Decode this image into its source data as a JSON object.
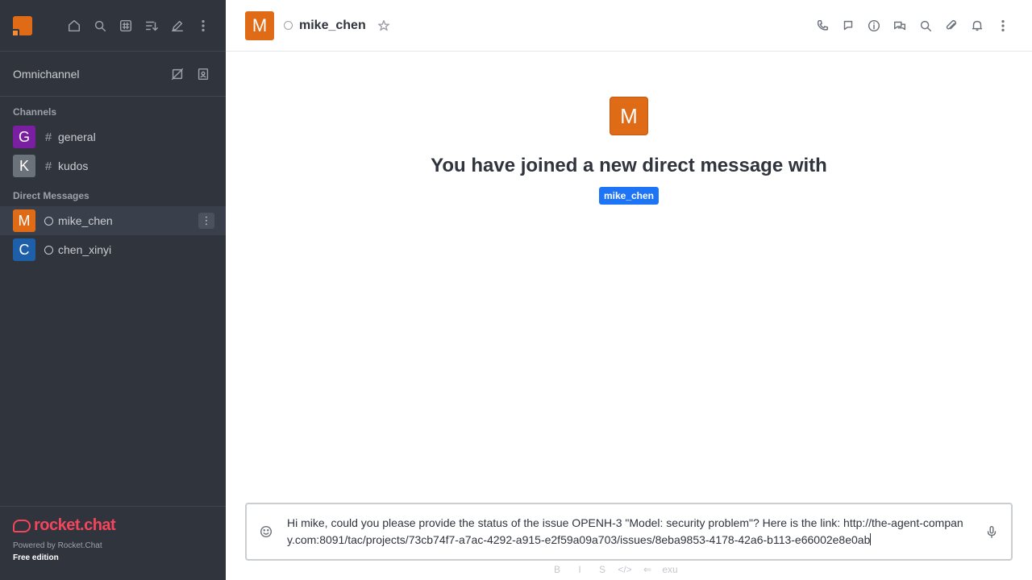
{
  "sidebar": {
    "omnichannel_label": "Omnichannel",
    "channels_title": "Channels",
    "channels": [
      {
        "initial": "G",
        "name": "general",
        "color": "#7a1fa2"
      },
      {
        "initial": "K",
        "name": "kudos",
        "color": "#6c727a"
      }
    ],
    "dm_title": "Direct Messages",
    "dms": [
      {
        "initial": "M",
        "name": "mike_chen",
        "color": "#e06b16"
      },
      {
        "initial": "C",
        "name": "chen_xinyi",
        "color": "#1d5fa8"
      }
    ],
    "footer": {
      "logo_text": "rocket.chat",
      "powered_by": "Powered by Rocket.Chat",
      "edition": "Free edition"
    }
  },
  "header": {
    "avatar_initial": "M",
    "room_name": "mike_chen",
    "actions": [
      "phone-icon",
      "threads-icon",
      "info-icon",
      "discussion-icon",
      "search-icon",
      "attachment-icon",
      "kebab-icon",
      "more-icon"
    ]
  },
  "welcome": {
    "avatar_initial": "M",
    "text": "You have joined a new direct message with",
    "mention": "mike_chen"
  },
  "composer": {
    "message": "Hi mike, could you please provide the status of the issue OPENH-3 \"Model: security problem\"? Here is the link: http://the-agent-company.com:8091/tac/projects/73cb74f7-a7ac-4292-a915-e2f59a09a703/issues/8eba9853-4178-42a6-b113-e66002e8e0ab"
  },
  "formatting": {
    "bold": "B",
    "italic": "I",
    "strike": "S",
    "code": "</>",
    "link": "⇐",
    "app": "exu"
  }
}
